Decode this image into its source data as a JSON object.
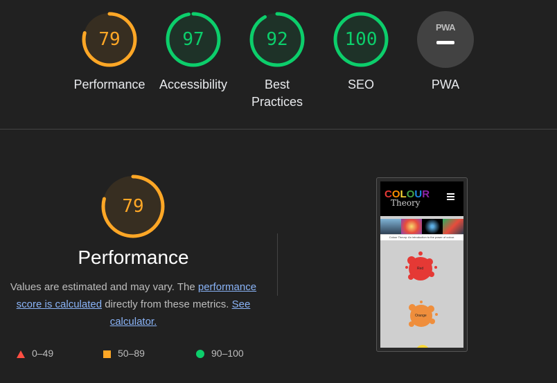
{
  "gauges": [
    {
      "score": "79",
      "label": "Performance",
      "value": 79,
      "color": "#ffa726"
    },
    {
      "score": "97",
      "label": "Accessibility",
      "value": 97,
      "color": "#0cce6b"
    },
    {
      "score": "92",
      "label": "Best Practices",
      "value": 92,
      "color": "#0cce6b"
    },
    {
      "score": "100",
      "label": "SEO",
      "value": 100,
      "color": "#0cce6b"
    }
  ],
  "pwa": {
    "badge_text": "PWA",
    "label": "PWA"
  },
  "performance": {
    "score": "79",
    "value": 79,
    "title": "Performance",
    "desc_prefix": "Values are estimated and may vary. The ",
    "desc_link": "performance score is calculated",
    "desc_mid": " directly from these metrics. ",
    "calc_link": "See calculator."
  },
  "legend": {
    "fail": "0–49",
    "average": "50–89",
    "pass": "90–100"
  },
  "screenshot": {
    "logo_top": "COLOUR",
    "logo_bottom": "Theory",
    "tagline": "Colour Theory: An introduction to the power of colour.",
    "splat_red": "Red",
    "splat_orange": "Orange"
  },
  "colors": {
    "average": "#ffa726",
    "pass": "#0cce6b",
    "fail": "#ff4e42",
    "link": "#8ab4f8"
  }
}
